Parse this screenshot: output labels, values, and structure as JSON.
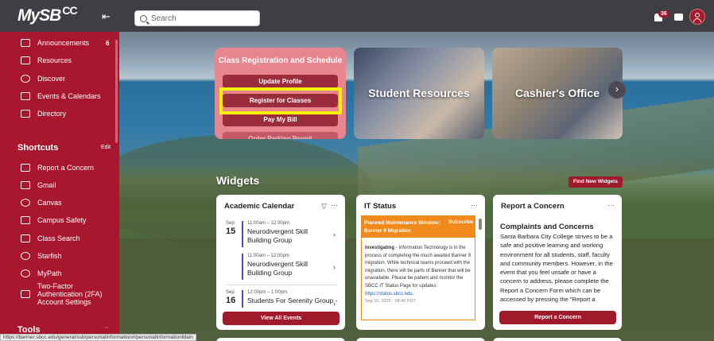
{
  "header": {
    "logo_main": "MySB",
    "logo_sub": "CC",
    "search_placeholder": "Search",
    "notification_count": "36"
  },
  "sidebar": {
    "items": [
      {
        "label": "Announcements",
        "count": "6",
        "icon": "megaphone-icon"
      },
      {
        "label": "Resources",
        "icon": "folder-icon"
      },
      {
        "label": "Discover",
        "icon": "compass-icon"
      },
      {
        "label": "Events & Calendars",
        "icon": "calendar-icon"
      },
      {
        "label": "Directory",
        "icon": "directory-icon"
      }
    ],
    "shortcuts_title": "Shortcuts",
    "shortcuts_edit": "Edit",
    "shortcuts": [
      {
        "label": "Report a Concern",
        "icon": "document-icon"
      },
      {
        "label": "Gmail",
        "icon": "mail-icon"
      },
      {
        "label": "Canvas",
        "icon": "canvas-icon"
      },
      {
        "label": "Campus Safety",
        "icon": "document-icon"
      },
      {
        "label": "Class Search",
        "icon": "document-icon"
      },
      {
        "label": "Starfish",
        "icon": "globe-icon"
      },
      {
        "label": "MyPath",
        "icon": "globe-icon"
      },
      {
        "label": "Two-Factor Authentication (2FA) Account Settings",
        "icon": "external-link-icon"
      }
    ],
    "tools_title": "Tools",
    "tools_more": "···"
  },
  "status_url": "https://banner.sbcc.edu/general/ssb/personalInformation#/personalInformationMain",
  "hero": {
    "registration": {
      "title": "Class Registration and Schedule",
      "buttons": [
        "Update Profile",
        "Register for Classes",
        "Pay My Bill",
        "Order Parking Permit"
      ]
    },
    "student_resources": "Student Resources",
    "cashiers_office": "Cashier's Office"
  },
  "widgets": {
    "title": "Widgets",
    "find_new": "Find New Widgets",
    "academic_calendar": {
      "title": "Academic Calendar",
      "events": [
        {
          "month": "Sep",
          "day": "15",
          "time": "11:00am – 12:00pm",
          "name": "Neurodivergent Skill Building Group"
        },
        {
          "month": "",
          "day": "",
          "time": "11:00am – 12:00pm",
          "name": "Neurodivergent Skill Building Group"
        },
        {
          "month": "Sep",
          "day": "16",
          "time": "12:00pm – 1:00pm",
          "name": "Students For Serenity Group -"
        }
      ],
      "view_all": "View All Events"
    },
    "it_status": {
      "title": "IT Status",
      "banner": "Planned Maintenance Window: Banner 9 Migration",
      "subscribe": "Subscribe",
      "lead": "Investigating",
      "body": " - Information Technology is in the process of completing the much awaited Banner 9 migration. While technical teams proceed with the migration, there will be parts of Banner that will be unavailable. Please be patient and monitor the SBCC IT Status Page for updates: ",
      "link": "https://status.sbcc.edu.",
      "timestamp": "Sep 10, 2025 - 08:40 PDT"
    },
    "report_concern": {
      "title": "Report a Concern",
      "heading": "Complaints and Concerns",
      "body": "Santa Barbara City College strives to be a safe and positive learning and working environment for all students, staff, faculty and community members. However, in the event that you feel unsafe or have a concern to address, please complete the Report a Concern Form which can be accessed by pressing the \"Report a",
      "button": "Report a Concern"
    }
  },
  "colors": {
    "brand": "#a01a2c",
    "sidebar": "#a8172d",
    "topbar": "#3d3f45",
    "highlight": "#f5f200",
    "it_orange": "#f08a1d"
  }
}
